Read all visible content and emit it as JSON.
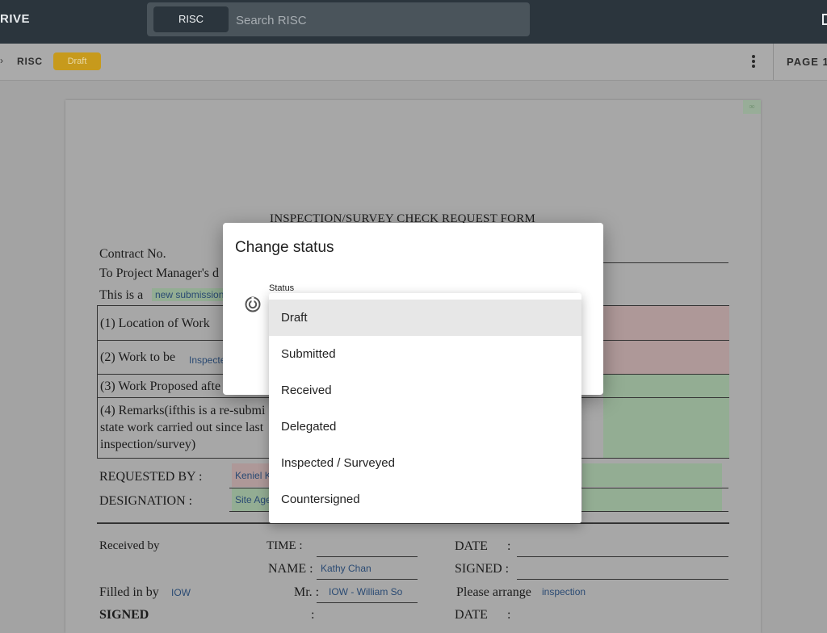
{
  "app": {
    "brand_partial": "RIVE",
    "search": {
      "scope_label": "RISC",
      "placeholder": "Search RISC"
    }
  },
  "subbar": {
    "breadcrumb": "RISC",
    "status_badge": "Draft",
    "page_indicator": "PAGE 1"
  },
  "colors": {
    "topbar": "#2b353d",
    "badge": "#c79a1c",
    "field_green": "#93ad93",
    "field_pink": "#ae9898",
    "field_text": "#2a4a73"
  },
  "document": {
    "link_icon": "link-icon",
    "form_title": "INSPECTION/SURVEY CHECK REQUEST FORM",
    "contract_label": "Contract No.",
    "to_pm_label": "To Project Manager's d",
    "this_is_a_label": "This is a",
    "submission_value": "new submission",
    "item1": "(1) Location of Work",
    "item2": "(2) Work to be",
    "item2_value": "Inspecte",
    "item3": "(3) Work Proposed afte",
    "item4_line1": "(4) Remarks(ifthis is a re-submi",
    "item4_line2": "state work carried out since last",
    "item4_line3": "inspection/survey)",
    "requested_by_label": "REQUESTED BY :",
    "requested_by_value": "Keniel K",
    "designation_label": "DESIGNATION :",
    "designation_value": "Site Age",
    "received_by_label": "Received by",
    "time_label": "TIME :",
    "date_label": "DATE",
    "colon": ":",
    "name_label": "NAME :",
    "name_value": "Kathy Chan",
    "signed_label": "SIGNED :",
    "filled_in_by_label": "Filled in by",
    "filled_in_by_value": "IOW",
    "mr_label": "Mr. :",
    "mr_value": "IOW - William So",
    "please_arrange_label": "Please arrange",
    "please_arrange_value": "inspection",
    "signed_bottom_label": "SIGNED",
    "date_bottom_label": "DATE"
  },
  "dialog": {
    "title": "Change status",
    "icon": "status-icon",
    "field_label": "Status",
    "options": [
      "Draft",
      "Submitted",
      "Received",
      "Delegated",
      "Inspected / Surveyed",
      "Countersigned"
    ],
    "selected": "Draft"
  }
}
